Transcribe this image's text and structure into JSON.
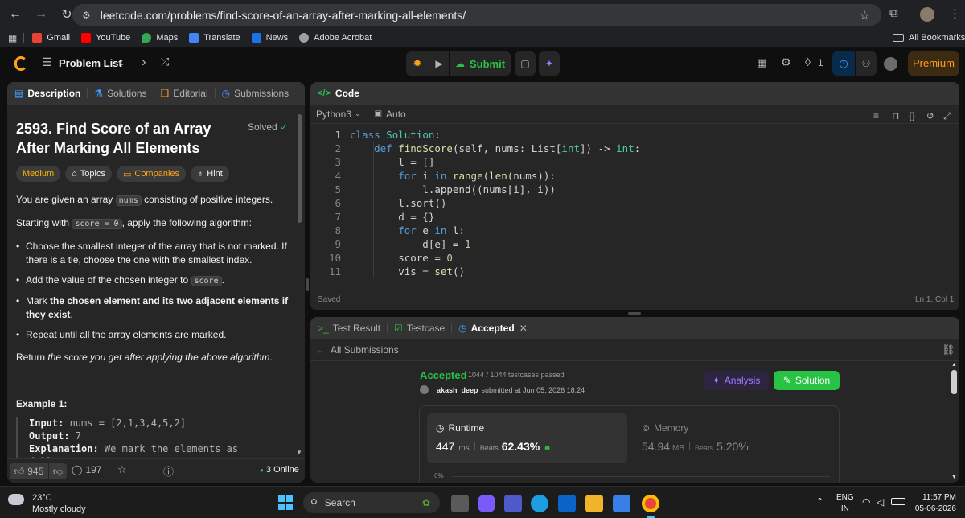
{
  "browser": {
    "url": "leetcode.com/problems/find-score-of-an-array-after-marking-all-elements/",
    "bookmarks": [
      "Gmail",
      "YouTube",
      "Maps",
      "Translate",
      "News",
      "Adobe Acrobat"
    ],
    "all_bookmarks": "All Bookmarks"
  },
  "header": {
    "problem_list": "Problem List",
    "submit": "Submit",
    "streak": "1",
    "premium": "Premium"
  },
  "left_panel": {
    "tabs": [
      "Description",
      "Solutions",
      "Editorial",
      "Submissions"
    ],
    "title_line1": "2593. Find Score of an Array",
    "title_line2": "After Marking All Elements",
    "solved": "Solved",
    "tags": [
      "Medium",
      "Topics",
      "Companies",
      "Hint"
    ],
    "p1_pre": "You are given an array",
    "p1_code": "nums",
    "p1_post": "consisting of positive integers.",
    "p2_pre": "Starting with",
    "p2_code": "score = 0",
    "p2_post": ", apply the following algorithm:",
    "b1_l1": "Choose the smallest integer of the array that is not marked. If",
    "b1_l2": "there is a tie, choose the one with the smallest index.",
    "b2_pre": "Add the value of the chosen integer to",
    "b2_code": "score",
    "b2_post": ".",
    "b3_pre": "Mark ",
    "b3_bold1": "the chosen element and its two adjacent elements if",
    "b3_bold2": "they exist",
    "b3_post": ".",
    "b4": "Repeat until all the array elements are marked.",
    "p3_pre": "Return ",
    "p3_em": "the score you get after applying the above algorithm",
    "p3_post": ".",
    "example_title": "Example 1:",
    "ex_input_label": "Input:",
    "ex_input_val": " nums = [2,1,3,4,5,2]",
    "ex_output_label": "Output:",
    "ex_output_val": " 7",
    "ex_expl_label": "Explanation:",
    "ex_expl_val": " We mark the elements as follows:",
    "likes": "945",
    "comments": "197",
    "online": "3 Online"
  },
  "code_panel": {
    "title": "Code",
    "language": "Python3",
    "auto": "Auto",
    "saved": "Saved",
    "cursor": "Ln 1, Col 1",
    "line_numbers": [
      "1",
      "2",
      "3",
      "4",
      "5",
      "6",
      "7",
      "8",
      "9",
      "10",
      "11"
    ]
  },
  "result_panel": {
    "tabs": [
      "Test Result",
      "Testcase",
      "Accepted"
    ],
    "back": "All Submissions",
    "status": "Accepted",
    "testcases": "1044 / 1044 testcases passed",
    "user": "_akash_deep",
    "submitted": "submitted at Jun 05, 2026 18:24",
    "analysis": "Analysis",
    "solution": "Solution",
    "runtime_label": "Runtime",
    "runtime_value": "447",
    "runtime_unit": "ms",
    "runtime_beats_label": "Beats",
    "runtime_beats": "62.43%",
    "memory_label": "Memory",
    "memory_value": "54.94",
    "memory_unit": "MB",
    "memory_beats_label": "Beats",
    "memory_beats": "5.20%",
    "chart_tick": "6%"
  },
  "taskbar": {
    "weather_temp": "23°C",
    "weather_desc": "Mostly cloudy",
    "search": "Search",
    "lang1": "ENG",
    "lang2": "IN",
    "time": "11:57 PM",
    "date": "05-06-2026"
  }
}
